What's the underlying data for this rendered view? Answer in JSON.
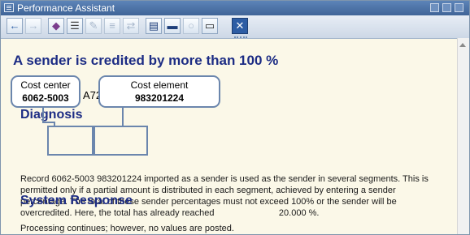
{
  "window": {
    "title": "Performance Assistant"
  },
  "toolbar": {
    "buttons": [
      {
        "icon": "back-arrow-icon"
      },
      {
        "icon": "forward-arrow-icon"
      },
      {
        "icon": "bookmark-icon"
      },
      {
        "icon": "technical-info-icon"
      },
      {
        "icon": "edit-icon"
      },
      {
        "icon": "notes-icon"
      },
      {
        "icon": "share-icon"
      },
      {
        "icon": "book-icon"
      },
      {
        "icon": "display-icon"
      },
      {
        "icon": "help-icon"
      },
      {
        "icon": "print-icon"
      },
      {
        "icon": "close-icon"
      }
    ]
  },
  "document": {
    "heading": "A sender is credited by more than 100 %",
    "fragment": "A72",
    "diagnosis_heading": "Diagnosis",
    "diagnosis_lines": [
      "Record 6062-5003 983201224 imported as a sender is used as the sender in several segments. This is",
      "permitted only if a partial amount is distributed in each segment, achieved by entering a sender",
      "percentage. The total of these sender percentages must not exceed 100% or the sender will be",
      "overcredited. Here, the total has already reached                          20.000 %."
    ],
    "system_response_heading": "System Response",
    "system_response_text": "Processing continues; however, no values are posted."
  },
  "callouts": {
    "cost_center": {
      "label": "Cost center",
      "value": "6062-5003"
    },
    "cost_element": {
      "label": "Cost element",
      "value": "983201224"
    }
  },
  "colors": {
    "title_bar": "#3f6497",
    "heading": "#1c2c84",
    "content_bg": "#fbf8e8",
    "callout_border": "#6b86ad"
  }
}
